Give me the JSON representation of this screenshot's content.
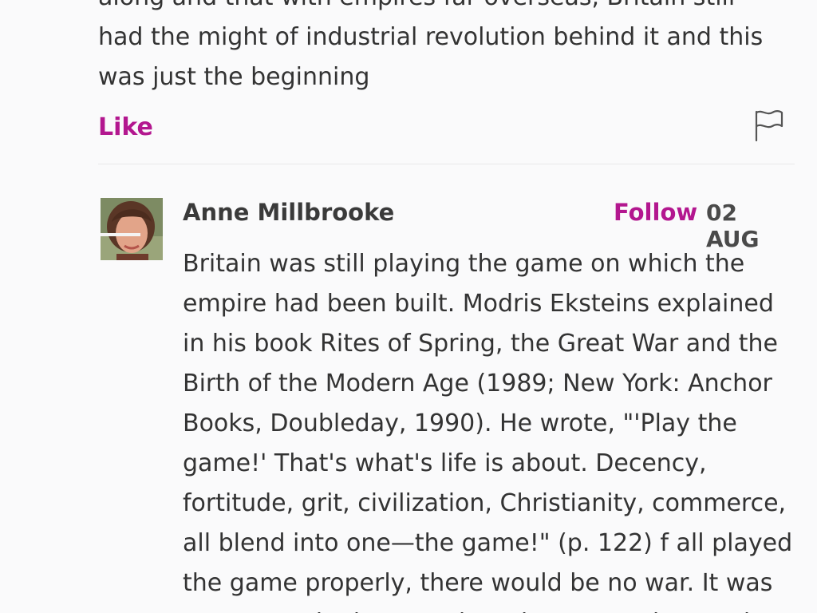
{
  "previous_comment": {
    "lines": [
      "along and that with empires far overseas, Britain still",
      "had the might of industrial revolution behind it and this",
      "was just the beginning"
    ],
    "like_label": "Like",
    "flag_icon": "flag-icon"
  },
  "comment": {
    "author": "Anne Millbrooke",
    "follow_label": "Follow",
    "date": "02 AUG",
    "lines": [
      "Britain was still playing the game on which the",
      "empire had been built. Modris Eksteins explained",
      "in his book Rites of Spring, the Great War and the",
      "Birth of the Modern Age (1989; New York: Anchor",
      "Books, Doubleday, 1990). He wrote, \"'Play the",
      "game!' That's what's life is about. Decency,",
      "fortitude, grit, civilization, Christianity, commerce,",
      "all blend into one—the game!\" (p. 122) f all played",
      "the game properly, there would be no war. It was",
      "not so much about territory but more about values"
    ]
  },
  "colors": {
    "accent": "#b3178f",
    "background": "#fafafb",
    "text": "#333333"
  }
}
